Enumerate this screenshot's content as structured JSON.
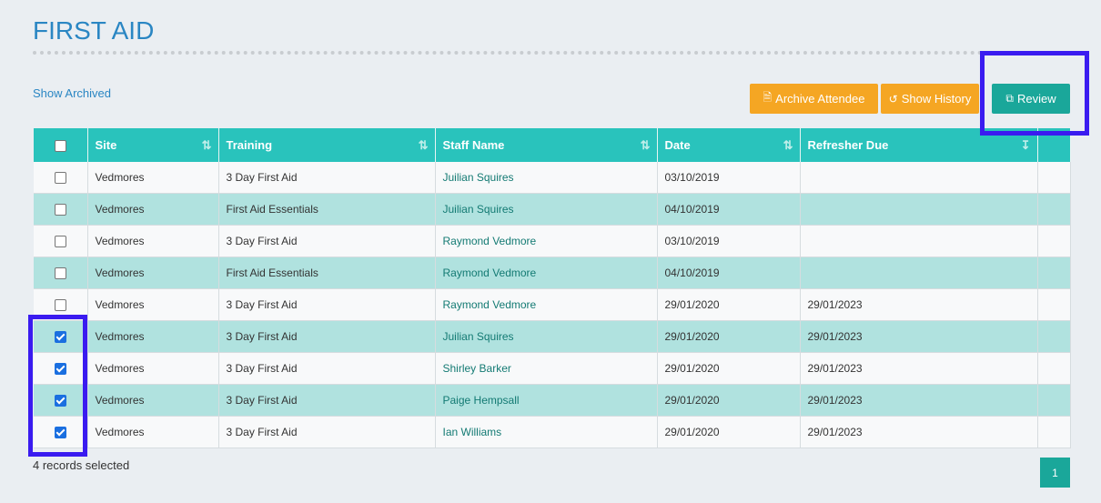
{
  "page": {
    "title": "FIRST AID"
  },
  "links": {
    "show_archived": "Show Archived"
  },
  "toolbar": {
    "archive_label": "Archive Attendee",
    "history_label": "Show History",
    "review_label": "Review"
  },
  "table": {
    "headers": [
      "Site",
      "Training",
      "Staff Name",
      "Date",
      "Refresher Due"
    ],
    "rows": [
      {
        "checked": false,
        "site": "Vedmores",
        "training": "3 Day First Aid",
        "staff": "Juilian Squires",
        "date": "03/10/2019",
        "refresher": ""
      },
      {
        "checked": false,
        "site": "Vedmores",
        "training": "First Aid Essentials",
        "staff": "Juilian Squires",
        "date": "04/10/2019",
        "refresher": ""
      },
      {
        "checked": false,
        "site": "Vedmores",
        "training": "3 Day First Aid",
        "staff": "Raymond Vedmore",
        "date": "03/10/2019",
        "refresher": ""
      },
      {
        "checked": false,
        "site": "Vedmores",
        "training": "First Aid Essentials",
        "staff": "Raymond Vedmore",
        "date": "04/10/2019",
        "refresher": ""
      },
      {
        "checked": false,
        "site": "Vedmores",
        "training": "3 Day First Aid",
        "staff": "Raymond Vedmore",
        "date": "29/01/2020",
        "refresher": "29/01/2023"
      },
      {
        "checked": true,
        "site": "Vedmores",
        "training": "3 Day First Aid",
        "staff": "Juilian Squires",
        "date": "29/01/2020",
        "refresher": "29/01/2023"
      },
      {
        "checked": true,
        "site": "Vedmores",
        "training": "3 Day First Aid",
        "staff": "Shirley Barker",
        "date": "29/01/2020",
        "refresher": "29/01/2023"
      },
      {
        "checked": true,
        "site": "Vedmores",
        "training": "3 Day First Aid",
        "staff": "Paige Hempsall",
        "date": "29/01/2020",
        "refresher": "29/01/2023"
      },
      {
        "checked": true,
        "site": "Vedmores",
        "training": "3 Day First Aid",
        "staff": "Ian Williams",
        "date": "29/01/2020",
        "refresher": "29/01/2023"
      }
    ]
  },
  "footer": {
    "records_selected": "4 records selected",
    "page_number": "1"
  },
  "colors": {
    "header": "#29c3bc",
    "accent_orange": "#f5a623",
    "accent_teal": "#1aa79a",
    "title_blue": "#2a86c3",
    "highlight": "#3a1bf0"
  }
}
